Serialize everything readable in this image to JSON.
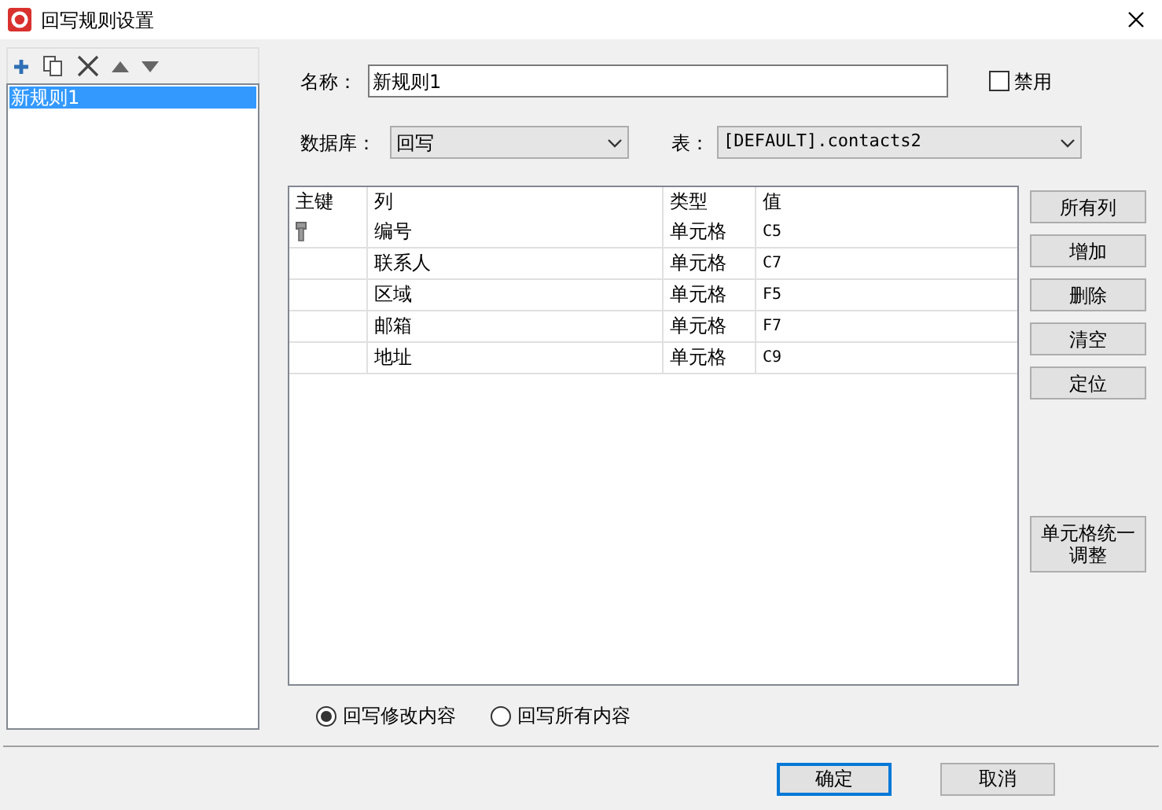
{
  "window": {
    "title": "回写规则设置"
  },
  "rules": [
    {
      "label": "新规则1",
      "selected": true
    }
  ],
  "name_label": "名称：",
  "name_value": "新规则1",
  "disable": {
    "label": "禁用",
    "checked": false
  },
  "database_label": "数据库：",
  "database_value": "回写",
  "table_label": "表：",
  "table_value": "[DEFAULT].contacts2",
  "table": {
    "columns": [
      "主键",
      "列",
      "类型",
      "值"
    ],
    "rows": [
      {
        "key": true,
        "column": "编号",
        "type": "单元格",
        "value": "C5"
      },
      {
        "key": false,
        "column": "联系人",
        "type": "单元格",
        "value": "C7"
      },
      {
        "key": false,
        "column": "区域",
        "type": "单元格",
        "value": "F5"
      },
      {
        "key": false,
        "column": "邮箱",
        "type": "单元格",
        "value": "F7"
      },
      {
        "key": false,
        "column": "地址",
        "type": "单元格",
        "value": "C9"
      }
    ]
  },
  "side_buttons": [
    "所有列",
    "增加",
    "删除",
    "清空",
    "定位"
  ],
  "adjust_button": [
    "单元格统一",
    "调整"
  ],
  "modes": [
    {
      "label": "回写修改内容",
      "selected": true
    },
    {
      "label": "回写所有内容",
      "selected": false
    }
  ],
  "ok": "确定",
  "cancel": "取消"
}
